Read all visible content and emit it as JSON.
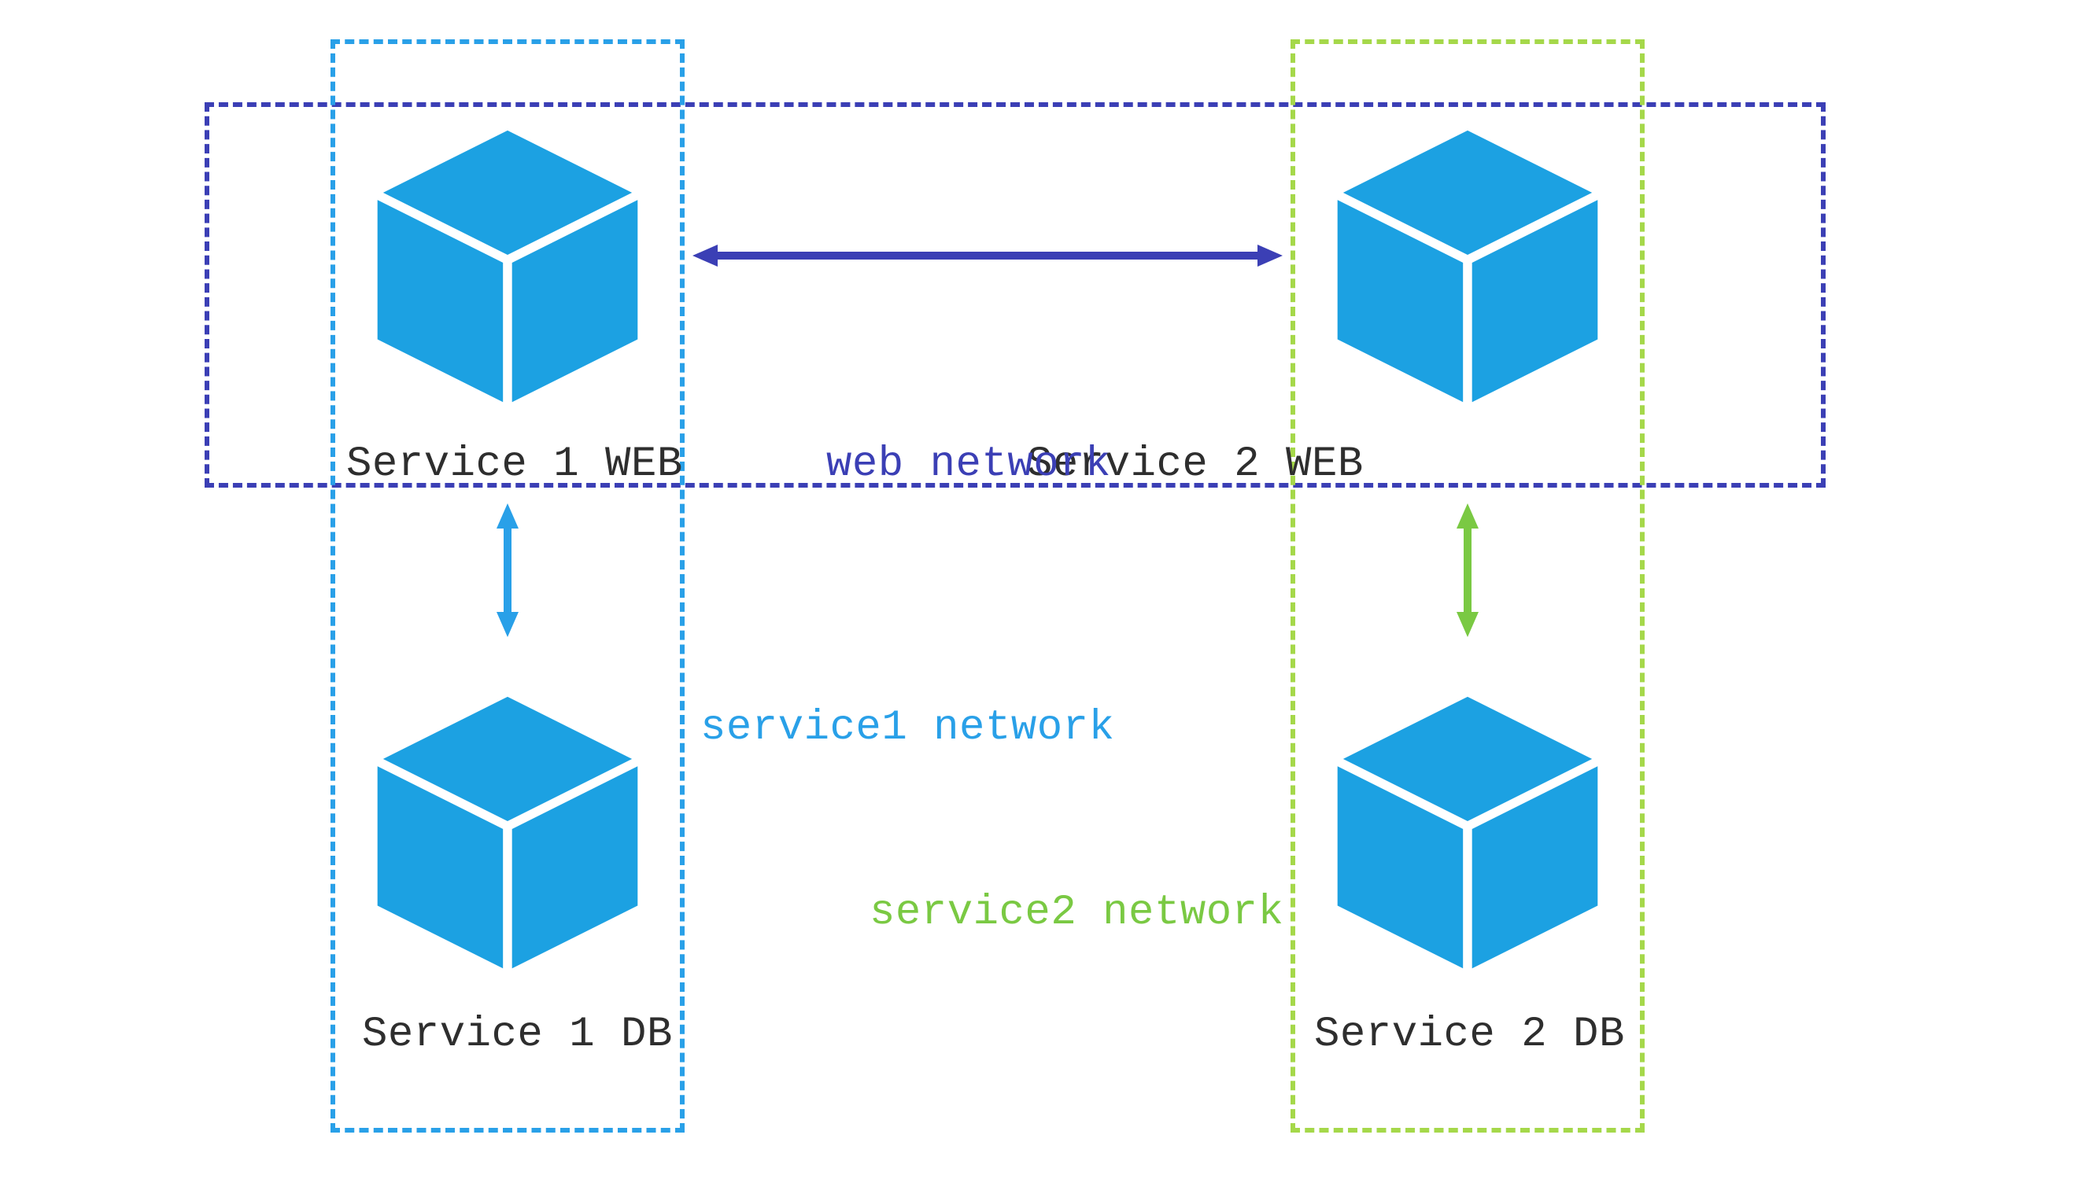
{
  "nodes": {
    "service1_web": {
      "label": "Service 1 WEB"
    },
    "service2_web": {
      "label": "Service 2 WEB"
    },
    "service1_db": {
      "label": "Service 1 DB"
    },
    "service2_db": {
      "label": "Service 2 DB"
    }
  },
  "networks": {
    "web": {
      "label": "web network",
      "color": "#3b3fb5"
    },
    "service1": {
      "label": "service1 network",
      "color": "#29a0e8"
    },
    "service2": {
      "label": "service2 network",
      "color": "#7ac943"
    }
  },
  "colors": {
    "cube_fill": "#1ca1e2",
    "cube_stroke": "#ffffff",
    "arrow_navy": "#3b3fb5",
    "arrow_blue": "#29a0e8",
    "arrow_green": "#7ac943"
  }
}
